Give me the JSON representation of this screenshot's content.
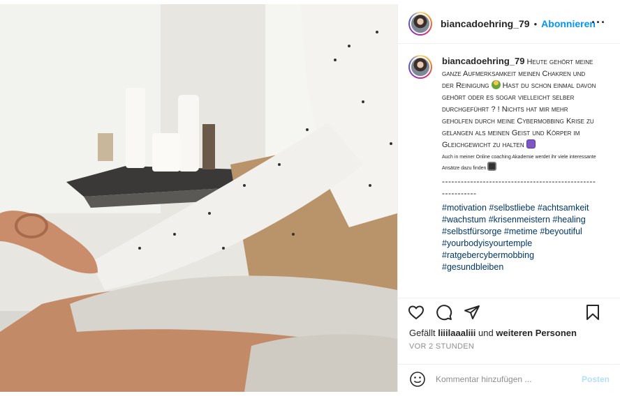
{
  "post": {
    "username": "biancadoehring_79",
    "separator": "•",
    "follow_label": "Abonnieren",
    "more_label": "···",
    "caption": {
      "text1": "Heute gehört meine ganze Aufmerksamkeit meinen Chakren und der Reinigung",
      "text2": "Hast du schon einmal davon gehört oder es sogar vielleicht selber durchgeführt ? ! Nichts hat mir mehr geholfen durch meine Cybermobbing Krise zu gelangen als meinen Geist und Körper im Gleichgewicht zu halten",
      "small_text": "Auch in meiner Online coaching Akademie werdet ihr viele interessante Ansätze dazu finden",
      "dashes": "------------------------------------------------------------",
      "hashtags": "#motivation #selbstliebe #achtsamkeit #wachstum #krisenmeistern #healing #selbstfürsorge #metime #beyoutiful #yourbodyisyourtemple #ratgebercybermobbing #gesundbleiben"
    },
    "likes": {
      "prefix": "Gefällt",
      "user": "liiilaaaliii",
      "joiner": "und",
      "others": "weiteren Personen"
    },
    "timestamp": "VOR 2 STUNDEN",
    "comment_placeholder": "Kommentar hinzufügen ...",
    "post_button": "Posten"
  },
  "colors": {
    "accent": "#0095f6",
    "post_disabled": "#b2dffc",
    "hashtag": "#00376b"
  },
  "icons": [
    "heart-icon",
    "comment-icon",
    "share-icon",
    "bookmark-icon",
    "emoji-icon",
    "more-icon"
  ]
}
